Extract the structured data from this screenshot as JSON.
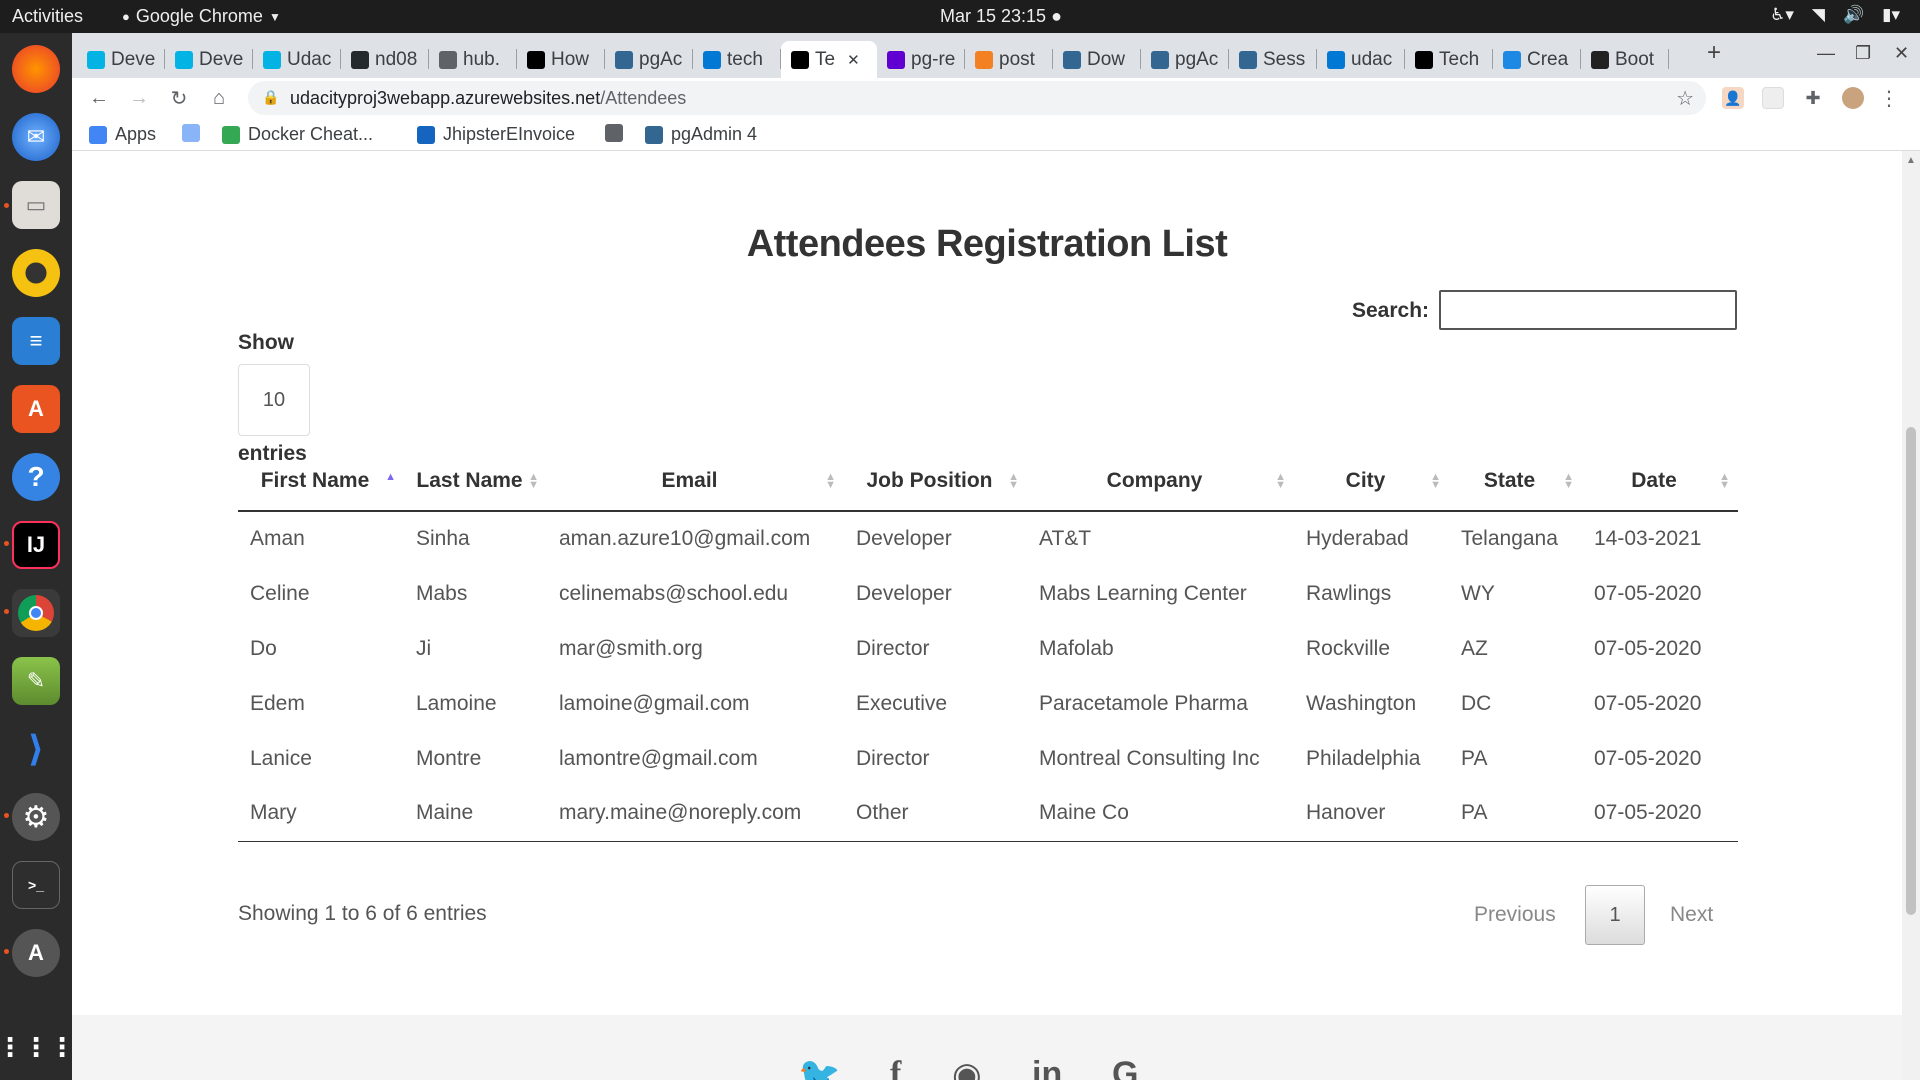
{
  "topbar": {
    "activities": "Activities",
    "app_name": "Google Chrome",
    "clock": "Mar 15  23:15"
  },
  "dock": {
    "items": [
      "firefox-icon",
      "thunderbird-icon",
      "files-icon",
      "rhythmbox-icon",
      "libreoffice-writer-icon",
      "ubuntu-software-icon",
      "help-icon",
      "intellij-icon",
      "chrome-icon",
      "gimp-icon",
      "vscode-icon",
      "settings-icon",
      "terminal-icon",
      "software-updater-icon",
      "show-apps-icon"
    ]
  },
  "tabs": [
    {
      "label": "Deve",
      "color": "#02b3e4"
    },
    {
      "label": "Deve",
      "color": "#02b3e4"
    },
    {
      "label": "Udac",
      "color": "#02b3e4"
    },
    {
      "label": "nd08",
      "color": "#24292e"
    },
    {
      "label": "hub.",
      "color": "#5f6368"
    },
    {
      "label": "How",
      "color": "#000000"
    },
    {
      "label": "pgAc",
      "color": "#336791"
    },
    {
      "label": "tech",
      "color": "#0078d4"
    },
    {
      "label": "Te",
      "color": "#000000"
    },
    {
      "label": "pg-re",
      "color": "#6001d2"
    },
    {
      "label": "post",
      "color": "#f48024"
    },
    {
      "label": "Dow",
      "color": "#336791"
    },
    {
      "label": "pgAc",
      "color": "#336791"
    },
    {
      "label": "Sess",
      "color": "#336791"
    },
    {
      "label": "udac",
      "color": "#0078d4"
    },
    {
      "label": "Tech",
      "color": "#000000"
    },
    {
      "label": "Crea",
      "color": "#1e88e5"
    },
    {
      "label": "Boot",
      "color": "#222222"
    }
  ],
  "tab_favicons": {
    "dev": "DEV",
    "tc": "TC",
    "yahoo": "y!",
    "pg": "Pg",
    "b": "b"
  },
  "toolbar": {
    "url_host": "udacityproj3webapp.azurewebsites.net",
    "url_path": "/Attendees"
  },
  "bookmarks": [
    {
      "label": "Apps"
    },
    {
      "label": ""
    },
    {
      "label": "Docker Cheat..."
    },
    {
      "label": "JhipsterEInvoice"
    },
    {
      "label": ""
    },
    {
      "label": "pgAdmin 4"
    }
  ],
  "page": {
    "title": "Attendees Registration List",
    "show_label": "Show",
    "show_value": "10",
    "entries_label": "entries",
    "search_label": "Search:",
    "search_value": "",
    "columns": [
      "First Name",
      "Last Name",
      "Email",
      "Job Position",
      "Company",
      "City",
      "State",
      "Date"
    ],
    "sorted_column": "First Name",
    "rows": [
      [
        "Aman",
        "Sinha",
        "aman.azure10@gmail.com",
        "Developer",
        "AT&T",
        "Hyderabad",
        "Telangana",
        "14-03-2021"
      ],
      [
        "Celine",
        "Mabs",
        "celinemabs@school.edu",
        "Developer",
        "Mabs Learning Center",
        "Rawlings",
        "WY",
        "07-05-2020"
      ],
      [
        "Do",
        "Ji",
        "mar@smith.org",
        "Director",
        "Mafolab",
        "Rockville",
        "AZ",
        "07-05-2020"
      ],
      [
        "Edem",
        "Lamoine",
        "lamoine@gmail.com",
        "Executive",
        "Paracetamole Pharma",
        "Washington",
        "DC",
        "07-05-2020"
      ],
      [
        "Lanice",
        "Montre",
        "lamontre@gmail.com",
        "Director",
        "Montreal Consulting Inc",
        "Philadelphia",
        "PA",
        "07-05-2020"
      ],
      [
        "Mary",
        "Maine",
        "mary.maine@noreply.com",
        "Other",
        "Maine Co",
        "Hanover",
        "PA",
        "07-05-2020"
      ]
    ],
    "info": "Showing 1 to 6 of 6 entries",
    "pagination": {
      "previous": "Previous",
      "current": "1",
      "next": "Next"
    }
  },
  "footer": {
    "social_icons": [
      "twitter-icon",
      "facebook-icon",
      "github-icon",
      "linkedin-icon",
      "google-icon"
    ]
  }
}
